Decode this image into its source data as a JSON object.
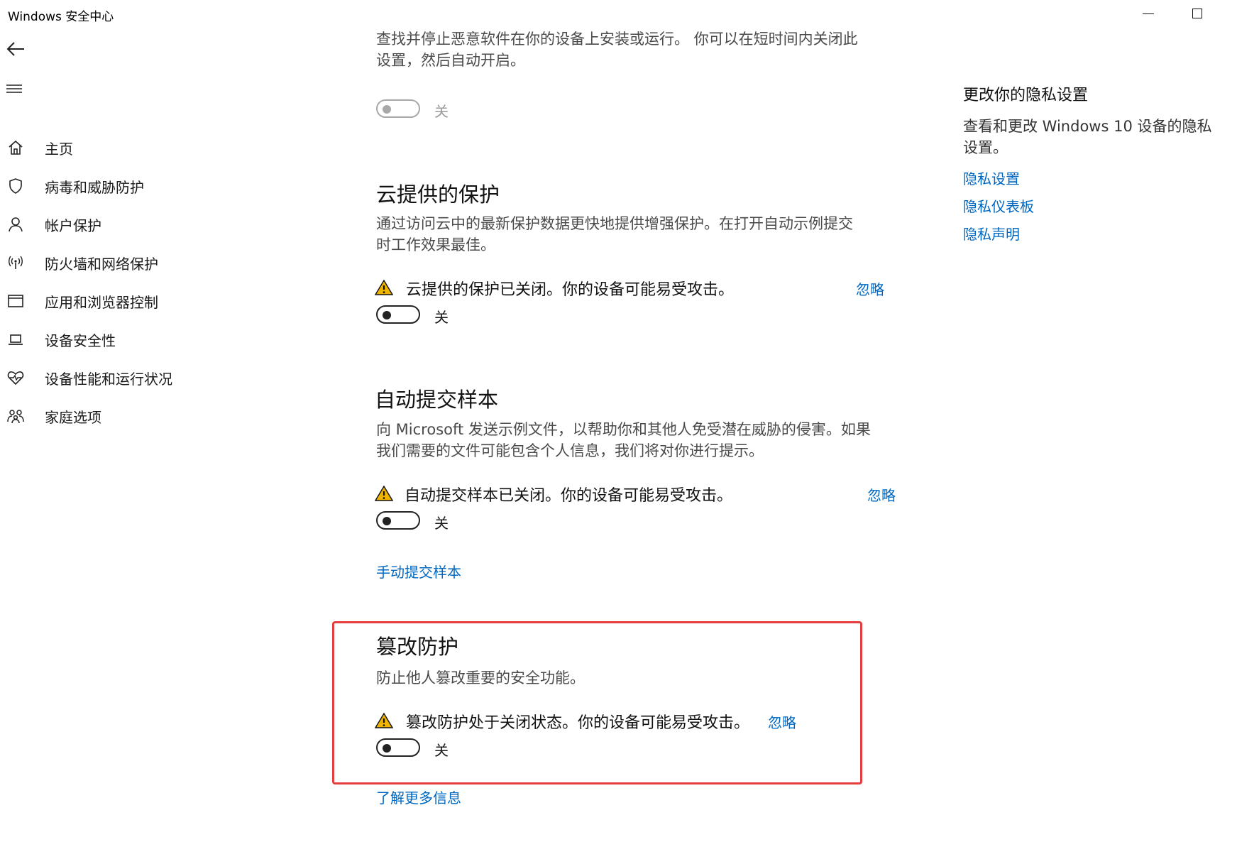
{
  "window": {
    "title": "Windows 安全中心"
  },
  "nav": {
    "items": [
      {
        "label": "主页",
        "icon": "home-icon"
      },
      {
        "label": "病毒和威胁防护",
        "icon": "shield-icon"
      },
      {
        "label": "帐户保护",
        "icon": "person-icon"
      },
      {
        "label": "防火墙和网络保护",
        "icon": "wifi-antenna-icon"
      },
      {
        "label": "应用和浏览器控制",
        "icon": "app-window-icon"
      },
      {
        "label": "设备安全性",
        "icon": "laptop-icon"
      },
      {
        "label": "设备性能和运行状况",
        "icon": "heart-pulse-icon"
      },
      {
        "label": "家庭选项",
        "icon": "family-icon"
      }
    ]
  },
  "realtime": {
    "desc_line1": "查找并停止恶意软件在你的设备上安装或运行。 你可以在短时间内关闭此",
    "desc_line2": "设置，然后自动开启。",
    "toggle_label": "关"
  },
  "cloud": {
    "title": "云提供的保护",
    "desc_line1": "通过访问云中的最新保护数据更快地提供增强保护。在打开自动示例提交",
    "desc_line2": "时工作效果最佳。",
    "warning": "云提供的保护已关闭。你的设备可能易受攻击。",
    "dismiss": "忽略",
    "toggle_label": "关"
  },
  "sample": {
    "title": "自动提交样本",
    "desc_line1": "向 Microsoft 发送示例文件，以帮助你和其他人免受潜在威胁的侵害。如果",
    "desc_line2": "我们需要的文件可能包含个人信息，我们将对你进行提示。",
    "warning": "自动提交样本已关闭。你的设备可能易受攻击。",
    "dismiss": "忽略",
    "toggle_label": "关",
    "manual_link": "手动提交样本"
  },
  "tamper": {
    "title": "篡改防护",
    "desc": "防止他人篡改重要的安全功能。",
    "warning": "篡改防护处于关闭状态。你的设备可能易受攻击。",
    "dismiss": "忽略",
    "toggle_label": "关",
    "learn_more": "了解更多信息"
  },
  "privacy": {
    "title": "更改你的隐私设置",
    "desc_line1": "查看和更改 Windows 10 设备的隐私",
    "desc_line2": "设置。",
    "links": [
      "隐私设置",
      "隐私仪表板",
      "隐私声明"
    ]
  },
  "colors": {
    "accent": "#0067c0",
    "warning": "#f0b400",
    "highlight": "#e53e3e"
  }
}
